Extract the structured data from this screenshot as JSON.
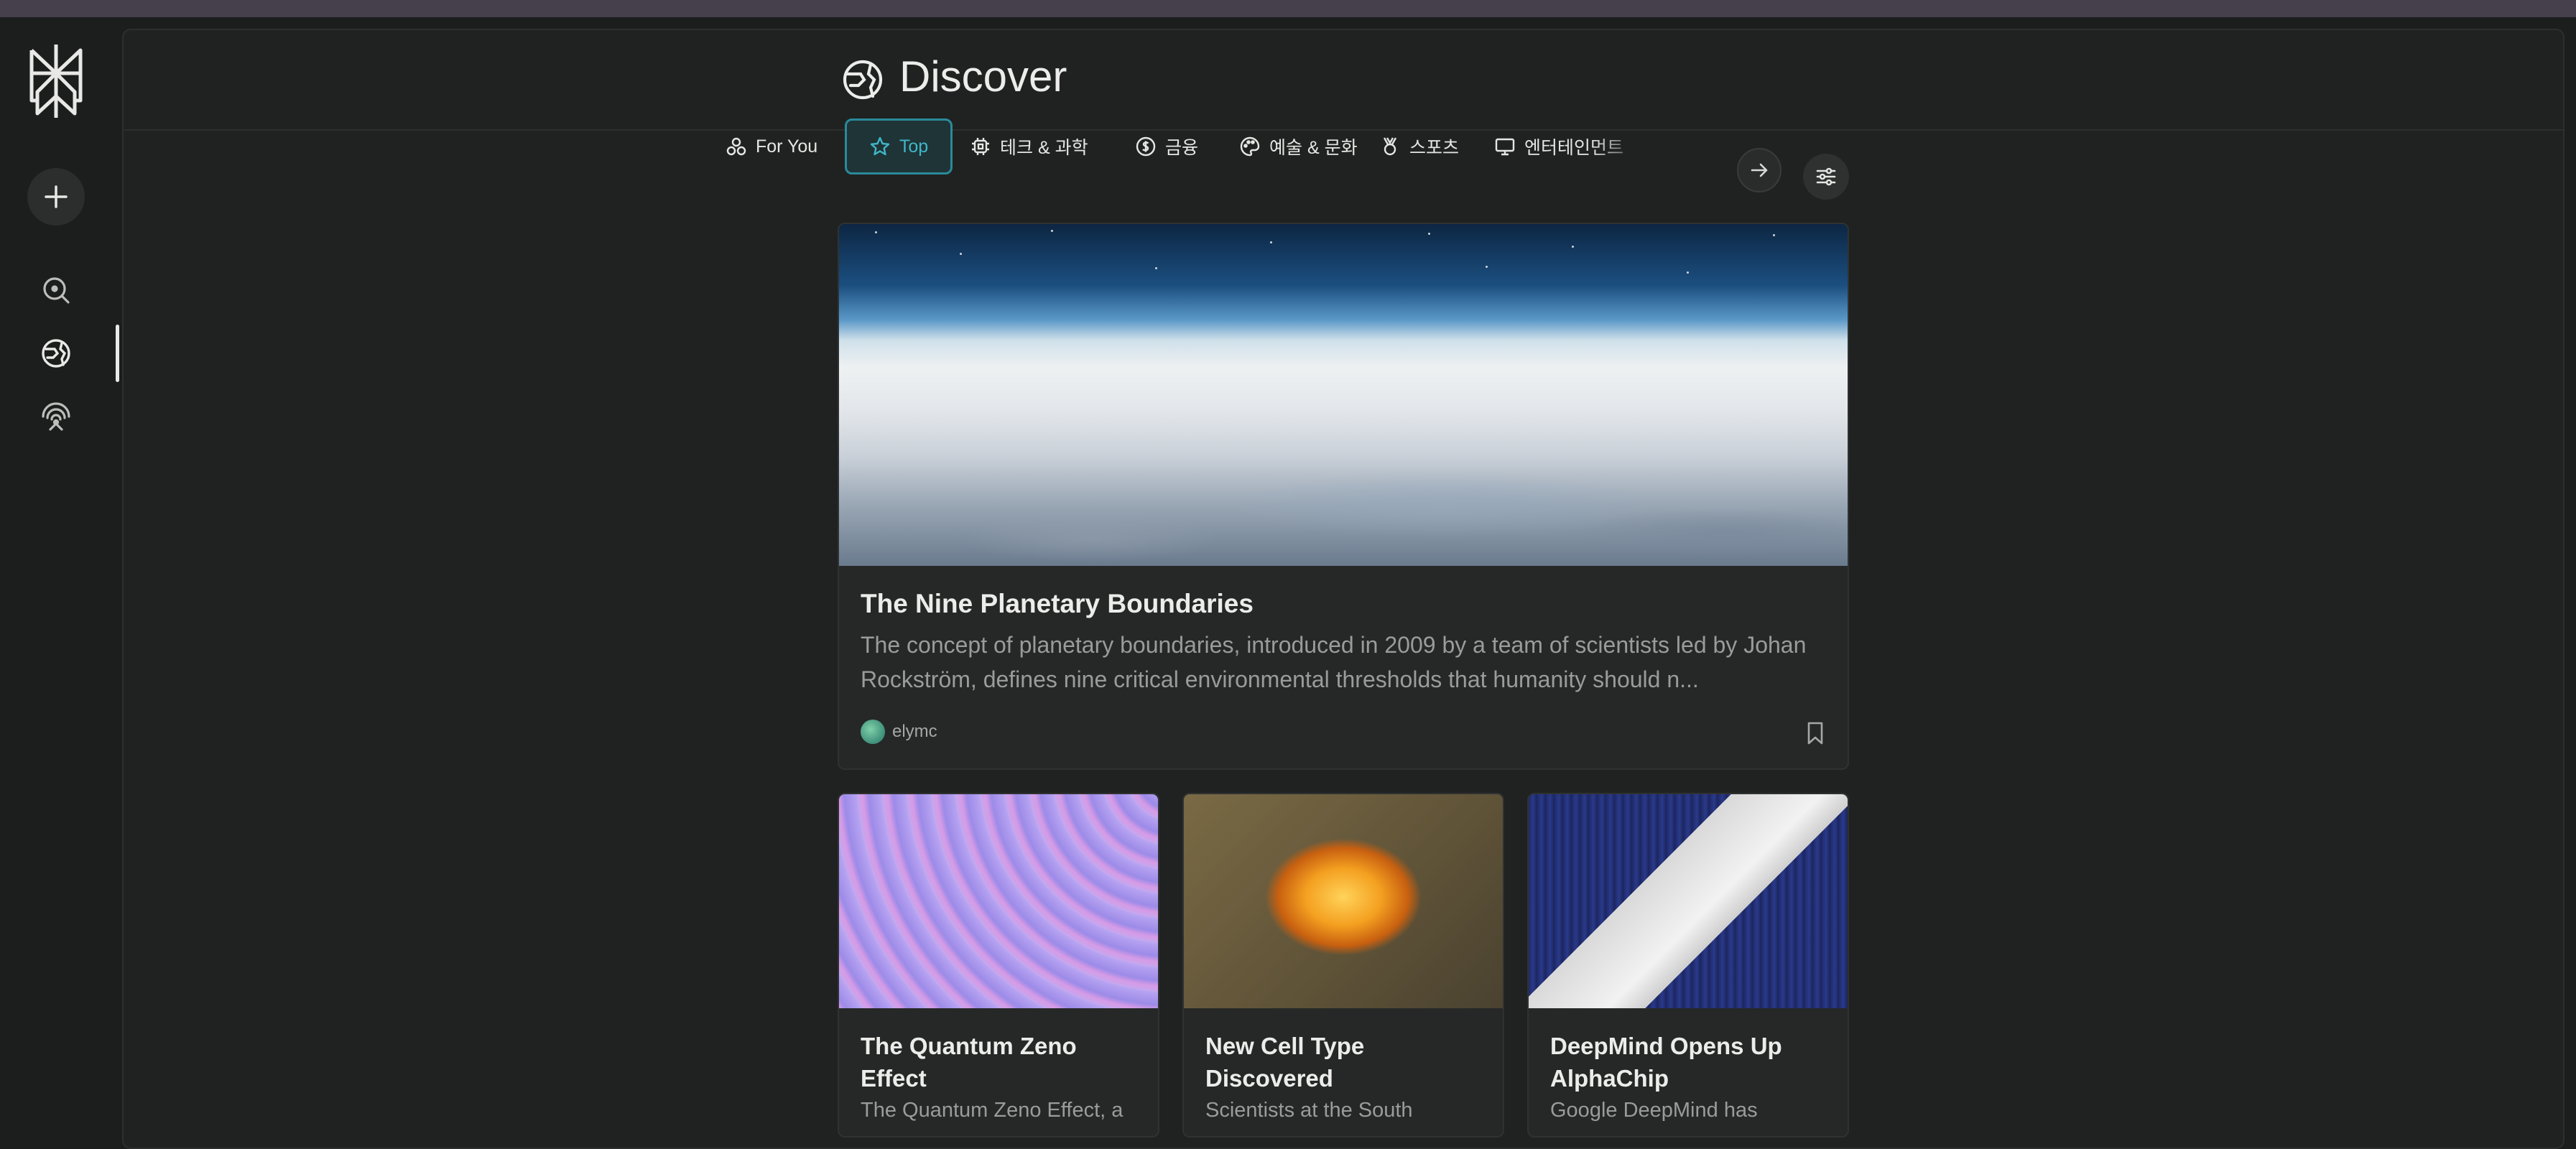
{
  "header": {
    "title": "Discover"
  },
  "tabs": [
    {
      "label": "For You",
      "icon": "users-icon",
      "active": false
    },
    {
      "label": "Top",
      "icon": "star-icon",
      "active": true
    },
    {
      "label": "테크 & 과학",
      "icon": "cpu-icon",
      "active": false
    },
    {
      "label": "금융",
      "icon": "dollar-icon",
      "active": false
    },
    {
      "label": "예술 & 문화",
      "icon": "palette-icon",
      "active": false
    },
    {
      "label": "스포츠",
      "icon": "medal-icon",
      "active": false
    },
    {
      "label": "엔터테인먼트",
      "icon": "monitor-icon",
      "active": false
    }
  ],
  "featured": {
    "title": "The Nine Planetary Boundaries",
    "summary": "The concept of planetary boundaries, introduced in 2009 by a team of scientists led by Johan Rockström, defines nine critical environmental thresholds that humanity should n...",
    "author": "elymc"
  },
  "cards": [
    {
      "title": "The Quantum Zeno Effect",
      "summary": "The Quantum Zeno Effect, a"
    },
    {
      "title": "New Cell Type Discovered",
      "summary": "Scientists at the South"
    },
    {
      "title": "DeepMind Opens Up AlphaChip",
      "summary": "Google DeepMind has"
    }
  ],
  "colors": {
    "accent": "#3fb7c8",
    "background": "#1c1d1d",
    "panel": "#202222",
    "card": "#262828"
  }
}
